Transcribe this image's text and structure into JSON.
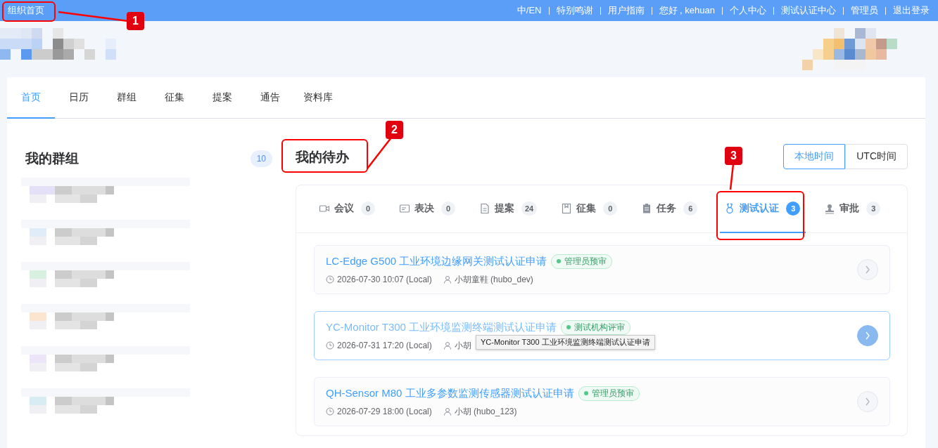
{
  "top_bar": {
    "title": "组织首页",
    "links": [
      "中/EN",
      "特别鸣谢",
      "用户指南",
      "您好 , kehuan",
      "个人中心",
      "测试认证中心",
      "管理员",
      "退出登录"
    ]
  },
  "nav_tabs": [
    {
      "label": "首页",
      "selected": true
    },
    {
      "label": "日历",
      "selected": false
    },
    {
      "label": "群组",
      "selected": false
    },
    {
      "label": "征集",
      "selected": false
    },
    {
      "label": "提案",
      "selected": false
    },
    {
      "label": "通告",
      "selected": false
    },
    {
      "label": "资料库",
      "selected": false
    }
  ],
  "my_groups": {
    "title": "我的群组",
    "count": "10"
  },
  "my_todos": {
    "title": "我的待办",
    "time_toggle": [
      {
        "label": "本地时间",
        "selected": true
      },
      {
        "label": "UTC时间",
        "selected": false
      }
    ],
    "tabs": [
      {
        "kind": "meeting",
        "label": "会议",
        "count": "0",
        "selected": false
      },
      {
        "kind": "vote",
        "label": "表决",
        "count": "0",
        "selected": false
      },
      {
        "kind": "proposal",
        "label": "提案",
        "count": "24",
        "selected": false
      },
      {
        "kind": "collect",
        "label": "征集",
        "count": "0",
        "selected": false
      },
      {
        "kind": "task",
        "label": "任务",
        "count": "6",
        "selected": false
      },
      {
        "kind": "certification",
        "label": "测试认证",
        "count": "3",
        "selected": true
      },
      {
        "kind": "approval",
        "label": "审批",
        "count": "3",
        "selected": false
      }
    ],
    "items": [
      {
        "title": "LC-Edge G500 工业环境边缘网关测试认证申请",
        "tag": "管理员预审",
        "time": "2026-07-30 10:07 (Local)",
        "user": "小胡童鞋 (hubo_dev)",
        "hovered": false
      },
      {
        "title": "YC-Monitor T300 工业环境监测终端测试认证申请",
        "tag": "测试机构评审",
        "time": "2026-07-31 17:20 (Local)",
        "user": "小胡",
        "hovered": true,
        "tooltip": "YC-Monitor T300 工业环境监测终端测试认证申请"
      },
      {
        "title": "QH-Sensor M80 工业多参数监测传感器测试认证申请",
        "tag": "管理员预审",
        "time": "2026-07-29 18:00 (Local)",
        "user": "小胡 (hubo_123)",
        "hovered": false
      }
    ]
  },
  "annotations": [
    {
      "number": "1"
    },
    {
      "number": "2"
    },
    {
      "number": "3"
    }
  ]
}
